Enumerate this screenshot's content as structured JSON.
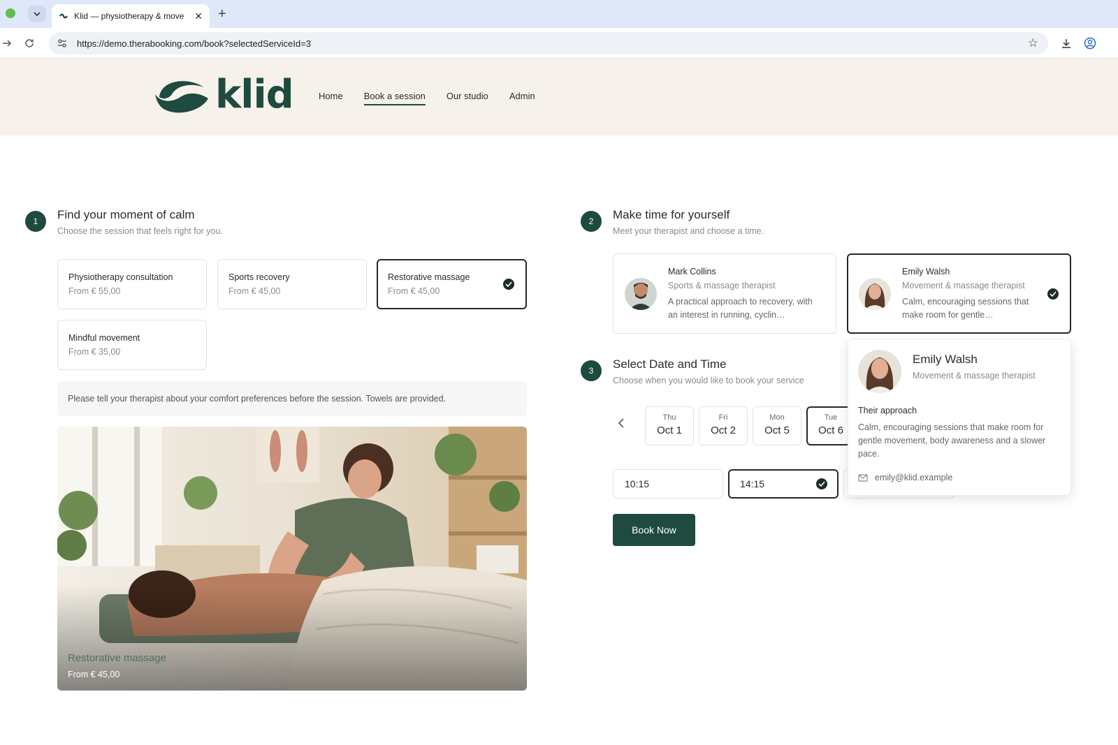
{
  "browser": {
    "tab_title": "Klid — physiotherapy & move",
    "url": "https://demo.therabooking.com/book?selectedServiceId=3"
  },
  "site": {
    "logo_text": "klid",
    "nav": [
      {
        "label": "Home",
        "active": false
      },
      {
        "label": "Book a session",
        "active": true
      },
      {
        "label": "Our studio",
        "active": false
      },
      {
        "label": "Admin",
        "active": false
      }
    ]
  },
  "step1": {
    "number": "1",
    "title": "Find your moment of calm",
    "subtitle": "Choose the session that feels right for you.",
    "services": [
      {
        "name": "Physiotherapy consultation",
        "price": "From € 55,00",
        "selected": false
      },
      {
        "name": "Sports recovery",
        "price": "From € 45,00",
        "selected": false
      },
      {
        "name": "Restorative massage",
        "price": "From € 45,00",
        "selected": true
      },
      {
        "name": "Mindful movement",
        "price": "From € 35,00",
        "selected": false
      }
    ],
    "notice": "Please tell your therapist about your comfort preferences before the session. Towels are provided.",
    "photo_caption": {
      "name": "Restorative massage",
      "price": "From € 45,00"
    }
  },
  "step2": {
    "number": "2",
    "title": "Make time for yourself",
    "subtitle": "Meet your therapist and choose a time.",
    "therapists": [
      {
        "name": "Mark Collins",
        "role": "Sports & massage therapist",
        "desc": "A practical approach to recovery, with an interest in running, cyclin…",
        "selected": false
      },
      {
        "name": "Emily Walsh",
        "role": "Movement & massage therapist",
        "desc": "Calm, encouraging sessions that make room for gentle…",
        "selected": true
      }
    ]
  },
  "popover": {
    "name": "Emily Walsh",
    "role": "Movement & massage therapist",
    "heading": "Their approach",
    "text": "Calm, encouraging sessions that make room for gentle movement, body awareness and a slower pace.",
    "email": "emily@klid.example"
  },
  "step3": {
    "number": "3",
    "title": "Select Date and Time",
    "subtitle": "Choose when you would like to book your service",
    "dates": [
      {
        "dow": "Thu",
        "day": "Oct 1",
        "selected": false
      },
      {
        "dow": "Fri",
        "day": "Oct 2",
        "selected": false
      },
      {
        "dow": "Mon",
        "day": "Oct 5",
        "selected": false
      },
      {
        "dow": "Tue",
        "day": "Oct 6",
        "selected": true
      }
    ],
    "times": [
      {
        "label": "10:15",
        "selected": false
      },
      {
        "label": "14:15",
        "selected": true
      }
    ],
    "book_label": "Book Now"
  },
  "colors": {
    "brand": "#1e4a40",
    "header_bg": "#f6f1ea",
    "selected_border": "#1e2b2a"
  },
  "icons": {
    "browser_back": "arrow-right-icon",
    "reload": "reload-icon",
    "bookmark": "star-icon",
    "download": "download-icon",
    "profile": "profile-icon",
    "check": "check-circle-icon",
    "email": "mail-icon",
    "prev": "chevron-left-icon"
  }
}
